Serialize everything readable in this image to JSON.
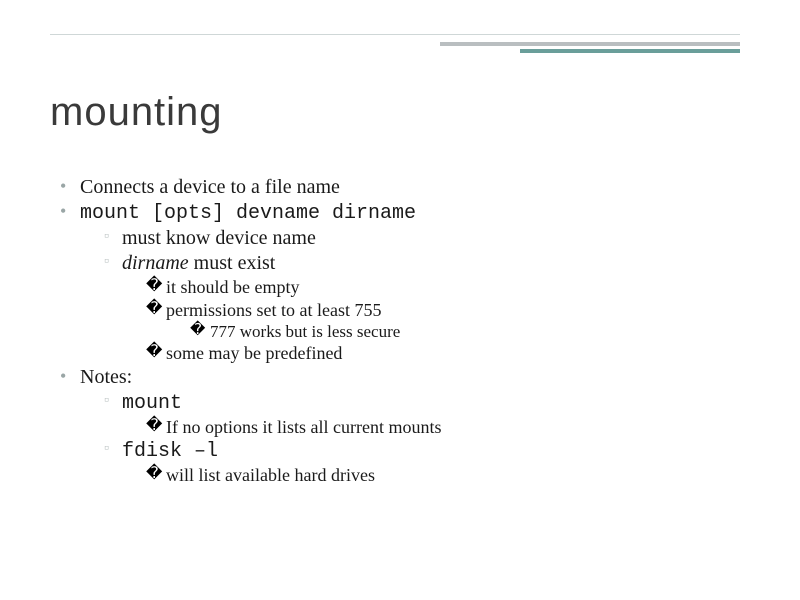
{
  "title": "mounting",
  "b1": "Connects a device to a file name",
  "b2": "mount [opts] devname dirname",
  "b2_1": "must know device name",
  "b2_2_pre": "dirname",
  "b2_2_post": " must exist",
  "b2_2a": "it should be empty",
  "b2_2b": "permissions set to at least 755",
  "b2_2b_i": "777 works but is less secure",
  "b2_2c": "some may be predefined",
  "b3": "Notes:",
  "b3_1": "mount",
  "b3_1a": "If no options it lists all current mounts",
  "b3_2": "fdisk –l",
  "b3_2a": "will list available hard drives"
}
